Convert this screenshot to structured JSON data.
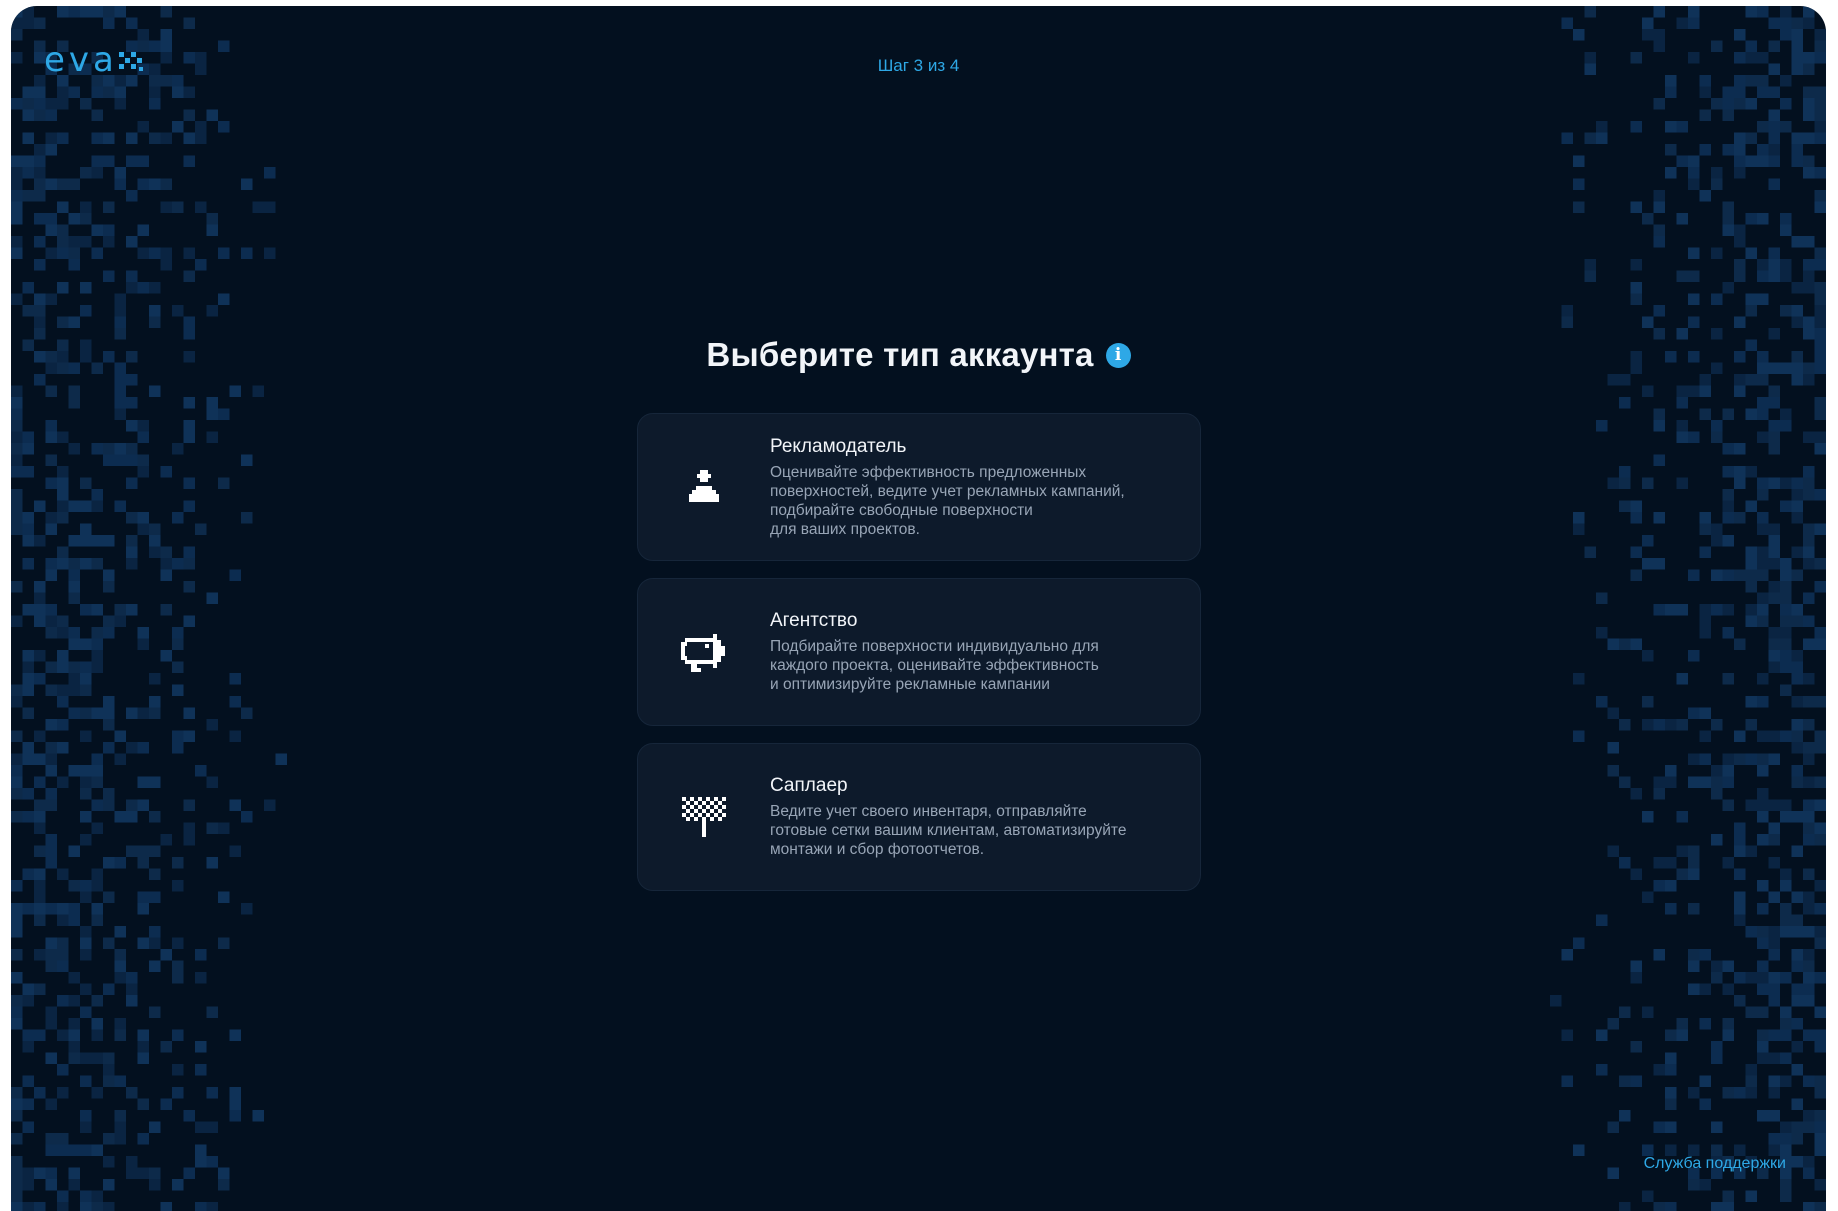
{
  "brand": {
    "logo_text": "eva",
    "accent_color": "#2ea8e6",
    "background_color": "#03101f"
  },
  "header": {
    "step_text": "Шаг 3 из 4"
  },
  "main": {
    "title": "Выберите тип аккаунта",
    "info_icon": "info-icon",
    "info_glyph": "i",
    "account_types": [
      {
        "icon": "advertiser-icon",
        "title": "Рекламодатель",
        "description": "Оценивайте эффективность предложенных\nповерхностей, ведите учет рекламных кампаний,\nподбирайте свободные поверхности\nдля ваших проектов."
      },
      {
        "icon": "agency-megaphone-icon",
        "title": "Агентство",
        "description": "Подбирайте поверхности индивидуально для\nкаждого проекта, оценивайте эффективность\nи оптимизируйте рекламные кампании"
      },
      {
        "icon": "supplier-billboard-icon",
        "title": "Саплаер",
        "description": "Ведите учет своего инвентаря, отправляйте\nготовые сетки вашим клиентам, автоматизируйте\nмонтажи и сбор фотоотчетов."
      }
    ]
  },
  "footer": {
    "support_link": "Служба поддержки"
  }
}
